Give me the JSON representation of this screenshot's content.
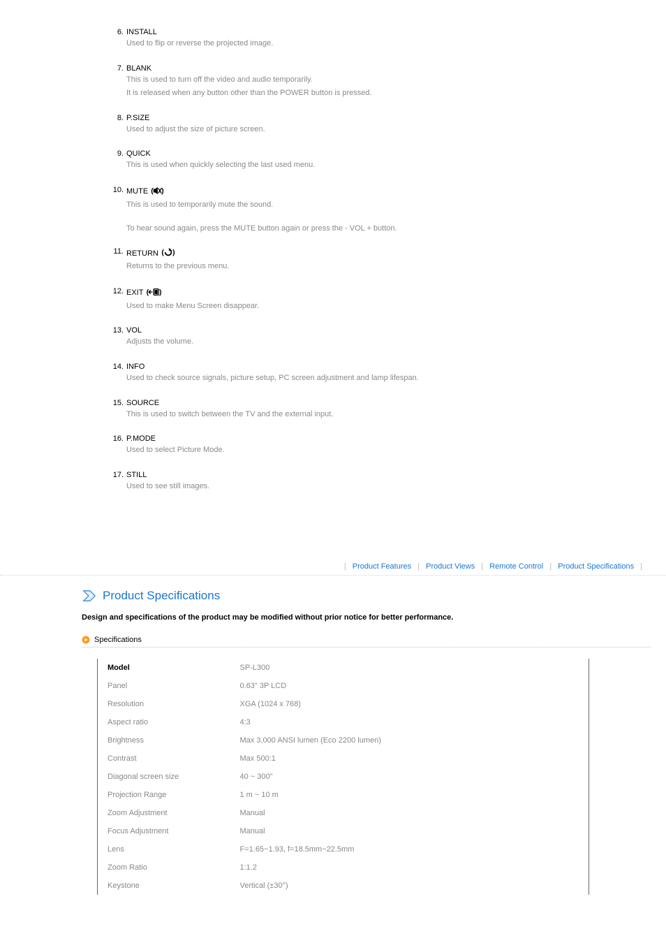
{
  "items": [
    {
      "num": "6.",
      "title": "INSTALL",
      "desc": [
        "Used to flip or reverse the projected image."
      ]
    },
    {
      "num": "7.",
      "title": "BLANK",
      "desc": [
        "This is used to turn off the video and audio temporarily.",
        "It is released when any button other than the POWER button is pressed."
      ]
    },
    {
      "num": "8.",
      "title": "P.SIZE",
      "desc": [
        "Used to adjust the size of picture screen."
      ]
    },
    {
      "num": "9.",
      "title": "QUICK",
      "desc": [
        "This is used when quickly selecting the last used menu."
      ]
    },
    {
      "num": "10.",
      "title": "MUTE",
      "icon": "mute",
      "desc": [
        "This is used to temporarily mute the sound."
      ],
      "extra": "To hear sound again, press the MUTE button again or press the - VOL + button."
    },
    {
      "num": "11.",
      "title": "RETURN",
      "icon": "return",
      "desc": [
        "Returns to the previous menu."
      ]
    },
    {
      "num": "12.",
      "title": "EXIT",
      "icon": "exit",
      "desc": [
        "Used to make Menu Screen disappear."
      ]
    },
    {
      "num": "13.",
      "title": "VOL",
      "desc": [
        "Adjusts the volume."
      ]
    },
    {
      "num": "14.",
      "title": "INFO",
      "desc": [
        "Used to check source signals, picture setup, PC screen adjustment and lamp lifespan."
      ]
    },
    {
      "num": "15.",
      "title": "SOURCE",
      "desc": [
        "This is used to switch between the TV and the external input."
      ]
    },
    {
      "num": "16.",
      "title": "P.MODE",
      "desc": [
        "Used to select Picture Mode."
      ]
    },
    {
      "num": "17.",
      "title": "STILL",
      "desc": [
        "Used to see still images."
      ]
    }
  ],
  "nav": {
    "product_features": "Product Features",
    "product_views": "Product Views",
    "remote_control": "Remote Control",
    "product_specifications": "Product Specifications"
  },
  "section": {
    "title": "Product Specifications",
    "note": "Design and specifications of the product may be modified without prior notice for better performance.",
    "sub": "Specifications"
  },
  "specs": [
    {
      "k": "Model",
      "v": "SP-L300"
    },
    {
      "k": "Panel",
      "v": "0.63\" 3P LCD"
    },
    {
      "k": "Resolution",
      "v": "XGA (1024 x 768)"
    },
    {
      "k": "Aspect ratio",
      "v": "4:3"
    },
    {
      "k": "Brightness",
      "v": "Max 3,000 ANSI lumen (Eco 2200 lumen)"
    },
    {
      "k": "Contrast",
      "v": "Max 500:1"
    },
    {
      "k": "Diagonal screen size",
      "v": "40 ~ 300\""
    },
    {
      "k": "Projection Range",
      "v": "1 m ~ 10 m"
    },
    {
      "k": "Zoom Adjustment",
      "v": "Manual"
    },
    {
      "k": "Focus Adjustment",
      "v": "Manual"
    },
    {
      "k": "Lens",
      "v": "F=1.65~1.93, f=18.5mm~22.5mm"
    },
    {
      "k": "Zoom Ratio",
      "v": "1:1.2"
    },
    {
      "k": "Keystone",
      "v": "Vertical (±30°)"
    }
  ]
}
